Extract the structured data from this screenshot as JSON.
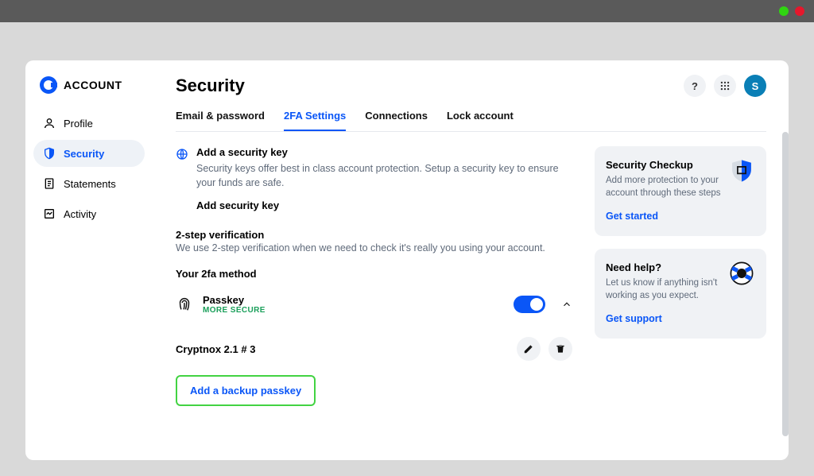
{
  "brand": "ACCOUNT",
  "sidebar": {
    "items": [
      {
        "label": "Profile"
      },
      {
        "label": "Security"
      },
      {
        "label": "Statements"
      },
      {
        "label": "Activity"
      }
    ]
  },
  "header": {
    "title": "Security",
    "avatar_initial": "S",
    "help": "?"
  },
  "tabs": [
    {
      "label": "Email & password"
    },
    {
      "label": "2FA Settings"
    },
    {
      "label": "Connections"
    },
    {
      "label": "Lock account"
    }
  ],
  "security_key": {
    "title": "Add a security key",
    "desc": "Security keys offer best in class account protection. Setup a security key to ensure your funds are safe.",
    "action": "Add security key"
  },
  "twostep": {
    "title": "2-step verification",
    "desc": "We use 2-step verification when we need to check it's really you using your account.",
    "method_label": "Your 2fa method",
    "method_name": "Passkey",
    "method_tag": "MORE SECURE"
  },
  "device": {
    "name": "Cryptnox 2.1 # 3"
  },
  "backup": {
    "label": "Add a backup passkey"
  },
  "checkup": {
    "title": "Security Checkup",
    "desc": "Add more protection to your account through these steps",
    "link": "Get started"
  },
  "help_panel": {
    "title": "Need help?",
    "desc": "Let us know if anything isn't working as you expect.",
    "link": "Get support"
  }
}
